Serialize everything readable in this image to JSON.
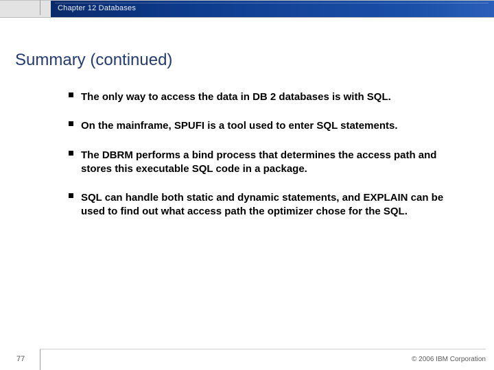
{
  "header": {
    "chapter": "Chapter 12 Databases"
  },
  "title": "Summary (continued)",
  "bullets": [
    "The only way to access the data in DB 2 databases is with SQL.",
    "On the mainframe, SPUFI is a tool used to enter SQL statements.",
    "The DBRM performs a bind process that determines the access path and stores this executable SQL code in a package.",
    "SQL can handle both static and dynamic statements, and EXPLAIN can be used to find out what access path the optimizer chose for the SQL."
  ],
  "footer": {
    "page_number": "77",
    "copyright": "© 2006 IBM Corporation"
  }
}
